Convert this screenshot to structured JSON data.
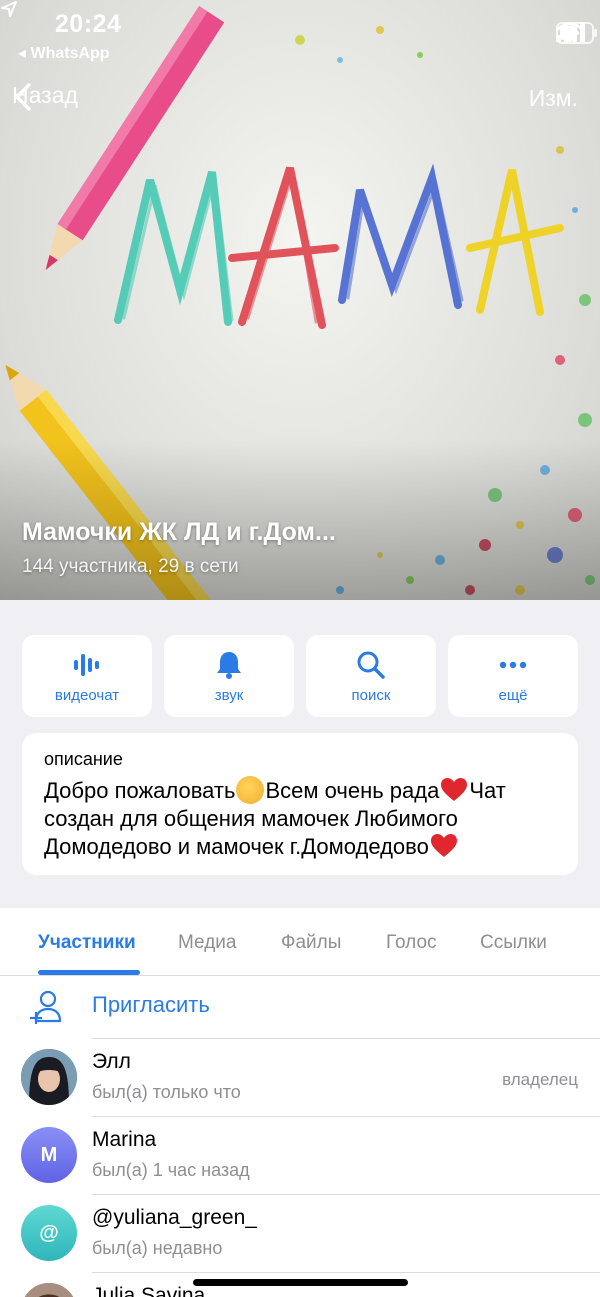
{
  "status_bar": {
    "time": "20:24",
    "back_app": "◂ WhatsApp",
    "icons": [
      "location-arrow-icon",
      "signal-icon",
      "wifi-icon",
      "battery-icon"
    ]
  },
  "nav": {
    "back_label": "Назад",
    "edit_label": "Изм."
  },
  "hero": {
    "image_lettering": "МАМА",
    "title": "Мамочки ЖК ЛД и г.Дом...",
    "subtitle": "144 участника, 29 в сети"
  },
  "actions": [
    {
      "label": "видеочат",
      "icon": "voice-wave-icon"
    },
    {
      "label": "звук",
      "icon": "bell-icon"
    },
    {
      "label": "поиск",
      "icon": "search-icon"
    },
    {
      "label": "ещё",
      "icon": "more-dots-icon"
    }
  ],
  "description": {
    "label": "описание",
    "line1_a": "Добро пожаловать",
    "line1_b": "Всем очень рада",
    "line1_c": "Чат",
    "line2": "создан для общения мамочек Любимого",
    "line3": "Домодедово и мамочек г.Домодедово"
  },
  "tabs": [
    {
      "label": "Участники",
      "active": true
    },
    {
      "label": "Медиа",
      "active": false
    },
    {
      "label": "Файлы",
      "active": false
    },
    {
      "label": "Голос",
      "active": false
    },
    {
      "label": "Ссылки",
      "active": false
    }
  ],
  "invite": {
    "label": "Пригласить"
  },
  "members": [
    {
      "name": "Элл",
      "status": "был(а) только что",
      "role": "владелец",
      "avatar_type": "photo"
    },
    {
      "name": "Marina",
      "status": "был(а) 1 час назад",
      "role": "",
      "avatar_letter": "M",
      "avatar_color": "#6f74f0"
    },
    {
      "name": "@yuliana_green_",
      "status": "был(а) недавно",
      "role": "",
      "avatar_letter": "@",
      "avatar_color": "#35c3c3"
    },
    {
      "name": "Julia Savina",
      "status": "",
      "role": "",
      "avatar_type": "photo"
    }
  ],
  "colors": {
    "accent": "#2a7be5",
    "background": "#efeff4",
    "secondary_text": "#8e8e93"
  }
}
